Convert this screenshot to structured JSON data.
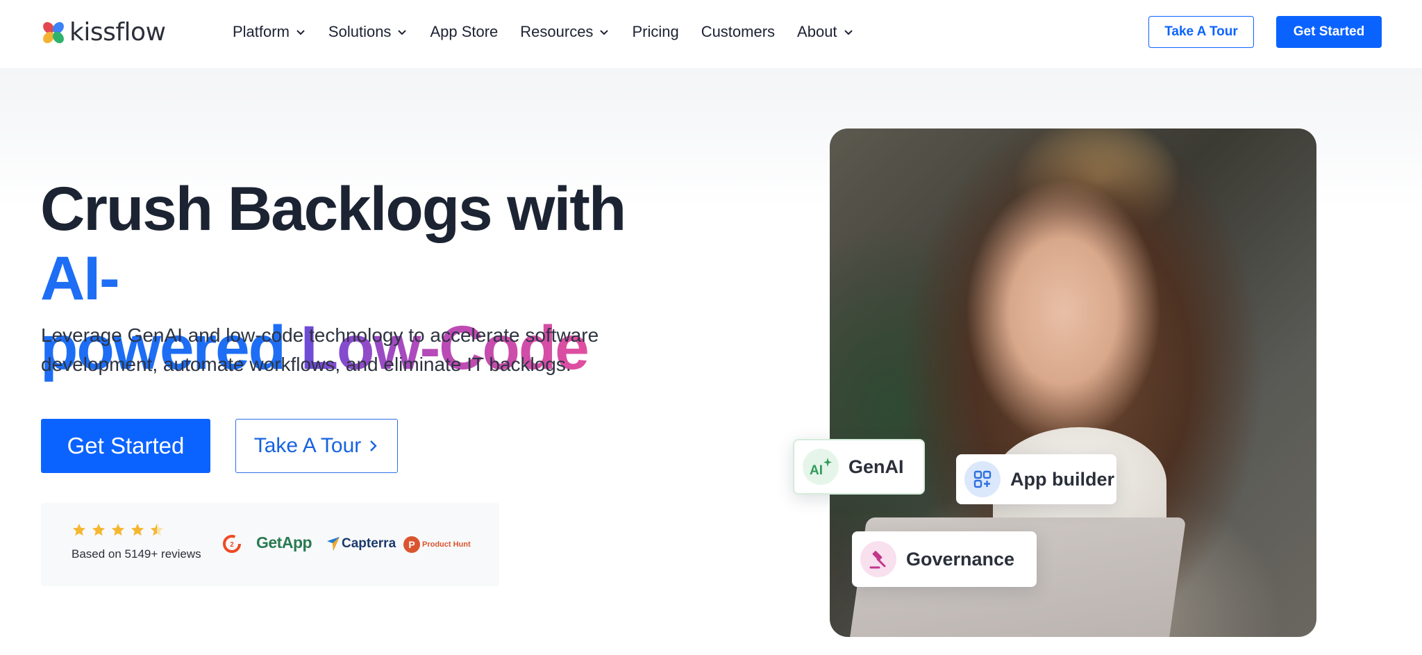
{
  "brand": {
    "name": "kissflow",
    "colors": {
      "primary": "#0b63ff",
      "heading": "#1c2433",
      "accent_blue": "#1d6ef5"
    }
  },
  "nav": {
    "items": [
      {
        "label": "Platform",
        "has_dropdown": true
      },
      {
        "label": "Solutions",
        "has_dropdown": true
      },
      {
        "label": "App Store",
        "has_dropdown": false
      },
      {
        "label": "Resources",
        "has_dropdown": true
      },
      {
        "label": "Pricing",
        "has_dropdown": false
      },
      {
        "label": "Customers",
        "has_dropdown": false
      },
      {
        "label": "About",
        "has_dropdown": true
      }
    ],
    "tour_label": "Take A Tour",
    "start_label": "Get Started"
  },
  "hero": {
    "headline_part1": "Crush Backlogs with ",
    "headline_part2": "AI-",
    "headline_part3": "powered ",
    "headline_part4": "Low-Code",
    "subtext": "Leverage GenAI and low-code technology to accelerate software development, automate workflows, and eliminate IT backlogs.",
    "cta_primary": "Get Started",
    "cta_secondary": "Take A Tour"
  },
  "reviews": {
    "rating_stars": 4.5,
    "text": "Based on 5149+ reviews",
    "sources": [
      "G2",
      "GetApp",
      "Capterra",
      "Product Hunt"
    ]
  },
  "badges": {
    "genai": {
      "label": "GenAI",
      "icon": "ai-sparkle-icon"
    },
    "app_builder": {
      "label": "App builder",
      "icon": "grid-plus-icon"
    },
    "governance": {
      "label": "Governance",
      "icon": "gavel-icon"
    }
  }
}
